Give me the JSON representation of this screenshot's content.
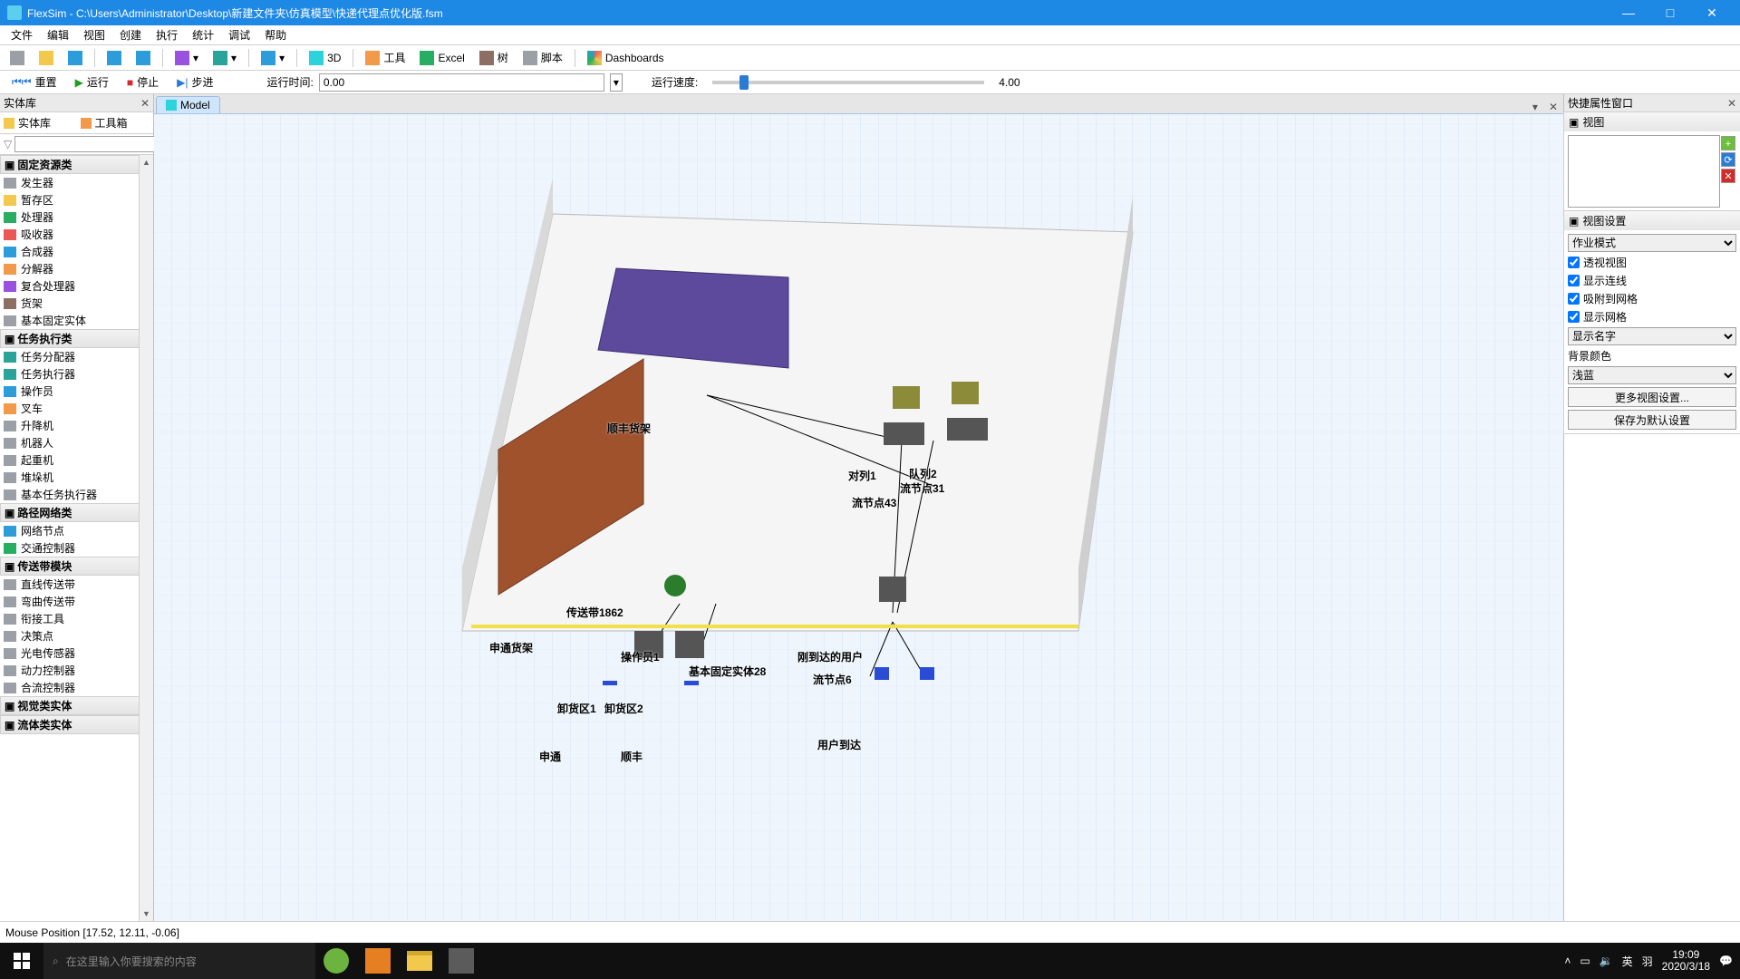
{
  "title": "FlexSim - C:\\Users\\Administrator\\Desktop\\新建文件夹\\仿真模型\\快递代理点优化版.fsm",
  "menu": {
    "file": "文件",
    "edit": "编辑",
    "view": "视图",
    "create": "创建",
    "run": "执行",
    "stats": "统计",
    "debug": "调试",
    "help": "帮助"
  },
  "toolbar": {
    "threeD": "3D",
    "tools": "工具",
    "excel": "Excel",
    "tree": "树",
    "script": "脚本",
    "dashboards": "Dashboards"
  },
  "runbar": {
    "reset": "重置",
    "run": "运行",
    "stop": "停止",
    "step": "步进",
    "runtime_label": "运行时间:",
    "runtime_value": "0.00",
    "speed_label": "运行速度:",
    "speed_value": "4.00"
  },
  "libraryPanel": {
    "title": "实体库",
    "tabs": {
      "lib": "实体库",
      "tools": "工具箱"
    },
    "groups": [
      {
        "name": "固定资源类",
        "items": [
          {
            "label": "发生器",
            "iconClass": "ic-gray"
          },
          {
            "label": "暂存区",
            "iconClass": "ic-yellow"
          },
          {
            "label": "处理器",
            "iconClass": "ic-green"
          },
          {
            "label": "吸收器",
            "iconClass": "ic-red"
          },
          {
            "label": "合成器",
            "iconClass": "ic-blue"
          },
          {
            "label": "分解器",
            "iconClass": "ic-orange"
          },
          {
            "label": "复合处理器",
            "iconClass": "ic-purple"
          },
          {
            "label": "货架",
            "iconClass": "ic-brown"
          },
          {
            "label": "基本固定实体",
            "iconClass": "ic-gray"
          }
        ]
      },
      {
        "name": "任务执行类",
        "items": [
          {
            "label": "任务分配器",
            "iconClass": "ic-teal"
          },
          {
            "label": "任务执行器",
            "iconClass": "ic-teal"
          },
          {
            "label": "操作员",
            "iconClass": "ic-blue"
          },
          {
            "label": "叉车",
            "iconClass": "ic-orange"
          },
          {
            "label": "升降机",
            "iconClass": "ic-gray"
          },
          {
            "label": "机器人",
            "iconClass": "ic-gray"
          },
          {
            "label": "起重机",
            "iconClass": "ic-gray"
          },
          {
            "label": "堆垛机",
            "iconClass": "ic-gray"
          },
          {
            "label": "基本任务执行器",
            "iconClass": "ic-gray"
          }
        ]
      },
      {
        "name": "路径网络类",
        "items": [
          {
            "label": "网络节点",
            "iconClass": "ic-blue"
          },
          {
            "label": "交通控制器",
            "iconClass": "ic-green"
          }
        ]
      },
      {
        "name": "传送带模块",
        "items": [
          {
            "label": "直线传送带",
            "iconClass": "ic-gray"
          },
          {
            "label": "弯曲传送带",
            "iconClass": "ic-gray"
          },
          {
            "label": "衔接工具",
            "iconClass": "ic-gray"
          },
          {
            "label": "决策点",
            "iconClass": "ic-gray"
          },
          {
            "label": "光电传感器",
            "iconClass": "ic-gray"
          },
          {
            "label": "动力控制器",
            "iconClass": "ic-gray"
          },
          {
            "label": "合流控制器",
            "iconClass": "ic-gray"
          }
        ]
      },
      {
        "name": "视觉类实体",
        "items": []
      },
      {
        "name": "流体类实体",
        "items": []
      }
    ]
  },
  "modelTab": "Model",
  "modelLabels": {
    "rack_sf": "顺丰货架",
    "rack_st": "申通货架",
    "conveyor": "传送带1862",
    "operator": "操作员1",
    "base_fixed": "基本固定实体28",
    "queue1": "对列1",
    "queue2": "队列2",
    "node31": "流节点31",
    "node43": "流节点43",
    "user_arrived": "刚到达的用户",
    "node6": "流节点6",
    "unload1": "卸货区1",
    "unload2": "卸货区2",
    "st": "申通",
    "sf": "顺丰",
    "user_src": "用户到达"
  },
  "propsPanel": {
    "title": "快捷属性窗口",
    "sec_view": "视图",
    "sec_view_settings": "视图设置",
    "work_mode": "作业模式",
    "cb_perspective": "透视视图",
    "cb_showlines": "显示连线",
    "cb_snap": "吸附到网格",
    "cb_showgrid": "显示网格",
    "show_name": "显示名字",
    "bg_label": "背景颜色",
    "bg_value": "浅蓝",
    "more": "更多视图设置...",
    "save_default": "保存为默认设置"
  },
  "status": "Mouse Position [17.52, 12.11, -0.06]",
  "taskbar": {
    "search_placeholder": "在这里输入你要搜索的内容",
    "ime": "英",
    "ime2": "羽",
    "time": "19:09",
    "date": "2020/3/18"
  }
}
